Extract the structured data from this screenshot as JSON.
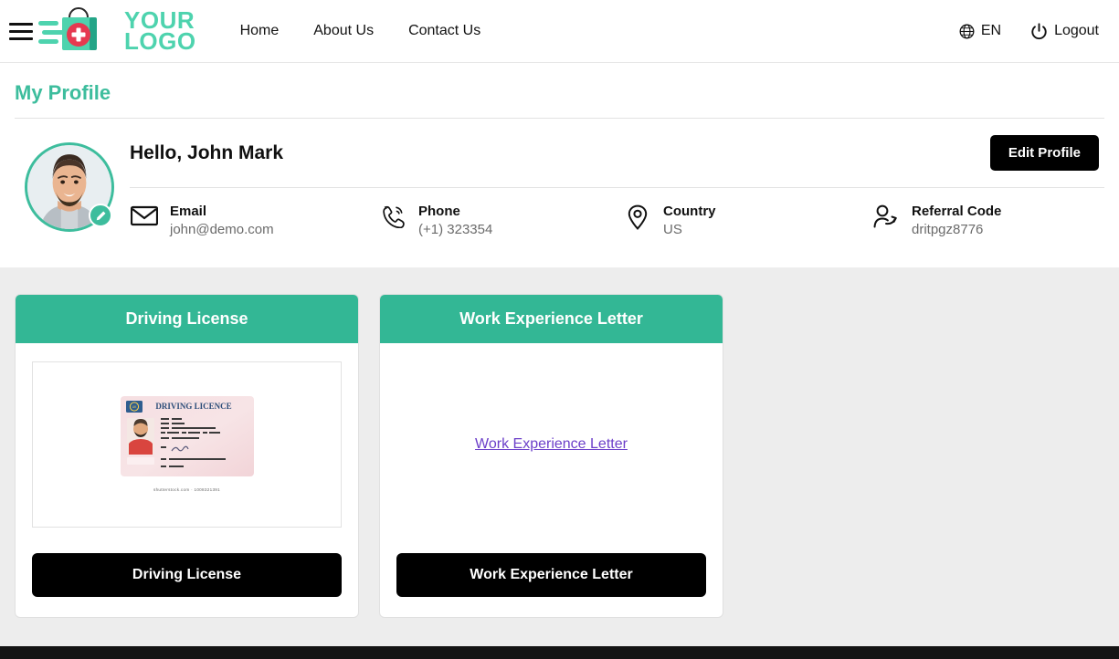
{
  "header": {
    "menu_icon": "hamburger-menu-icon",
    "logo": {
      "line1": "YOUR",
      "line2": "LOGO",
      "icon": "medical-shopping-bag-logo-icon",
      "color": "#4ed3ae"
    },
    "nav": [
      {
        "label": "Home"
      },
      {
        "label": "About Us"
      },
      {
        "label": "Contact Us"
      }
    ],
    "language": {
      "icon": "globe-icon",
      "label": "EN"
    },
    "logout": {
      "icon": "power-icon",
      "label": "Logout"
    }
  },
  "page": {
    "title": "My Profile"
  },
  "profile": {
    "avatar_alt": "user-avatar-photo",
    "edit_badge_icon": "pencil-icon",
    "greeting": "Hello, John Mark",
    "edit_profile_label": "Edit Profile",
    "fields": [
      {
        "icon": "envelope-icon",
        "label": "Email",
        "value": "john@demo.com"
      },
      {
        "icon": "phone-icon",
        "label": "Phone",
        "value": "(+1) 323354"
      },
      {
        "icon": "location-pin-icon",
        "label": "Country",
        "value": "US"
      },
      {
        "icon": "referral-person-icon",
        "label": "Referral Code",
        "value": "dritpgz8776"
      }
    ]
  },
  "documents": [
    {
      "header": "Driving License",
      "button_label": "Driving License",
      "preview_type": "image",
      "preview_title": "DRIVING LICENCE",
      "preview_caption": "shutterstock.com · 1008321391",
      "link_label": ""
    },
    {
      "header": "Work Experience Letter",
      "button_label": "Work Experience Letter",
      "preview_type": "link",
      "preview_title": "",
      "preview_caption": "",
      "link_label": "Work Experience Letter"
    }
  ],
  "theme": {
    "accent_teal": "#33b795",
    "title_teal": "#3dbd9d",
    "logo_green": "#4ed3ae",
    "button_black": "#000000",
    "page_bg": "#ededed",
    "link_purple": "#6c3fc9",
    "footer_dark": "#141414"
  }
}
